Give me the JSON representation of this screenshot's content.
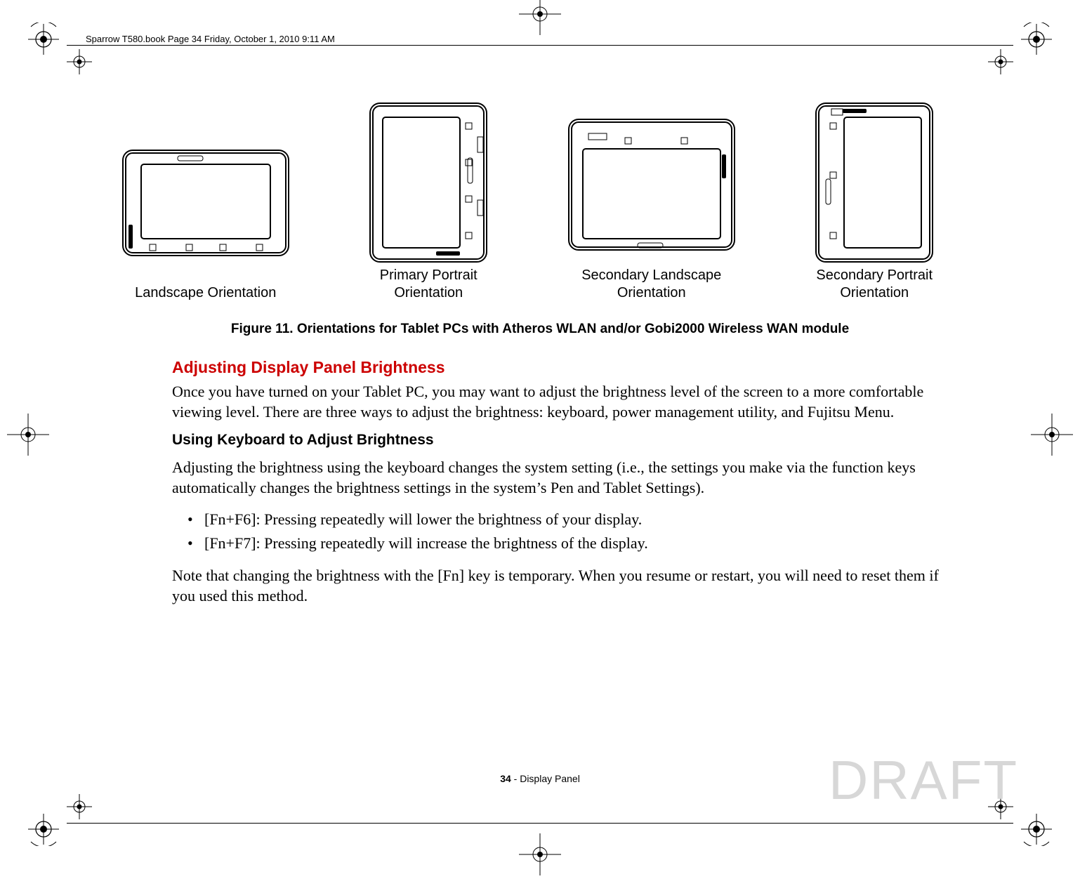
{
  "printer_header": "Sparrow T580.book  Page 34  Friday, October 1, 2010  9:11 AM",
  "figure": {
    "items": [
      {
        "label": "Landscape Orientation"
      },
      {
        "label": "Primary Portrait\nOrientation"
      },
      {
        "label": "Secondary Landscape\nOrientation"
      },
      {
        "label": "Secondary Portrait\nOrientation"
      }
    ],
    "caption": "Figure 11.  Orientations for Tablet PCs with Atheros WLAN and/or Gobi2000 Wireless WAN module"
  },
  "section": {
    "heading_red": "Adjusting Display Panel Brightness",
    "para1": "Once you have turned on your Tablet PC, you may want to adjust the brightness level of the screen to a more comfortable viewing level. There are three ways to adjust the brightness: keyboard, power management utility, and Fujitsu Menu.",
    "heading_black": "Using Keyboard to Adjust Brightness",
    "para2": "Adjusting the brightness using the keyboard changes the system setting (i.e., the settings you make via the function keys automatically changes the brightness settings in the system’s Pen and Tablet Settings).",
    "bullets": [
      "[Fn+F6]: Pressing repeatedly will lower the brightness of your display.",
      "[Fn+F7]: Pressing repeatedly will increase the brightness of the display."
    ],
    "para3": "Note that changing the brightness with the [Fn] key is temporary. When you resume or restart, you will need to reset them if you used this method."
  },
  "footer": {
    "page_num": "34",
    "page_label": " - Display Panel"
  },
  "watermark": "DRAFT"
}
